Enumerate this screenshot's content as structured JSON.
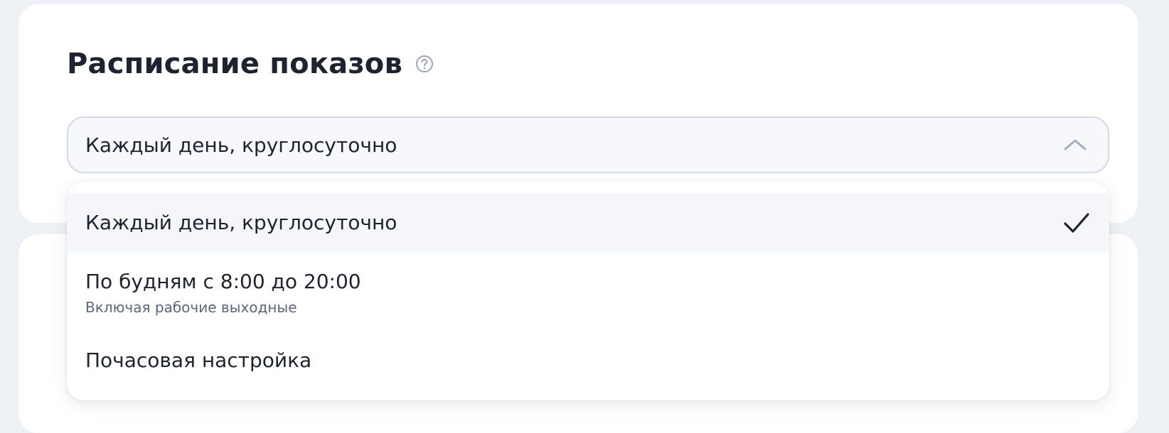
{
  "section": {
    "title": "Расписание показов",
    "help_icon": "question-circle-icon"
  },
  "select": {
    "value": "Каждый день, круглосуточно",
    "expanded": true,
    "chevron_icon": "chevron-up-icon"
  },
  "dropdown": {
    "options": [
      {
        "label": "Каждый день, круглосуточно",
        "selected": true,
        "icon": "checkmark-icon"
      },
      {
        "label": "По будням с 8:00 до 20:00",
        "sublabel": "Включая рабочие выходные",
        "selected": false
      },
      {
        "label": "Почасовая настройка",
        "selected": false
      }
    ]
  },
  "colors": {
    "page_background": "#eef1f5",
    "card_background": "#ffffff",
    "text_primary": "#1d2330",
    "text_secondary": "#5b6781",
    "selected_row": "#f5f6fa",
    "border": "#d6dae3"
  }
}
